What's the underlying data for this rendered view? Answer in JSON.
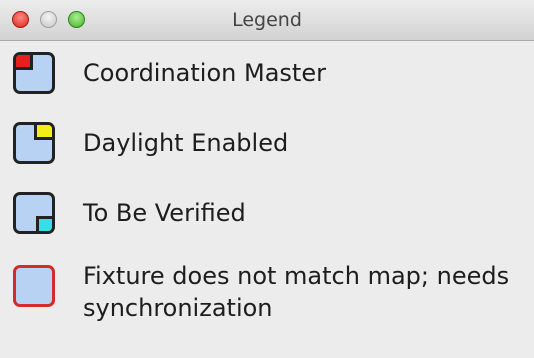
{
  "window": {
    "title": "Legend"
  },
  "legend": {
    "items": [
      {
        "label": "Coordination Master",
        "marker": "top-left",
        "marker_color": "#e6201b",
        "border_color": "#222222"
      },
      {
        "label": "Daylight Enabled",
        "marker": "top-right",
        "marker_color": "#f3ed18",
        "border_color": "#222222"
      },
      {
        "label": "To Be Verified",
        "marker": "bottom-right",
        "marker_color": "#34dfe7",
        "border_color": "#222222"
      },
      {
        "label": "Fixture does not match map; needs synchronization",
        "marker": "none",
        "marker_color": "",
        "border_color": "#d42a2a"
      }
    ],
    "swatch_fill": "#b8d2f4"
  }
}
